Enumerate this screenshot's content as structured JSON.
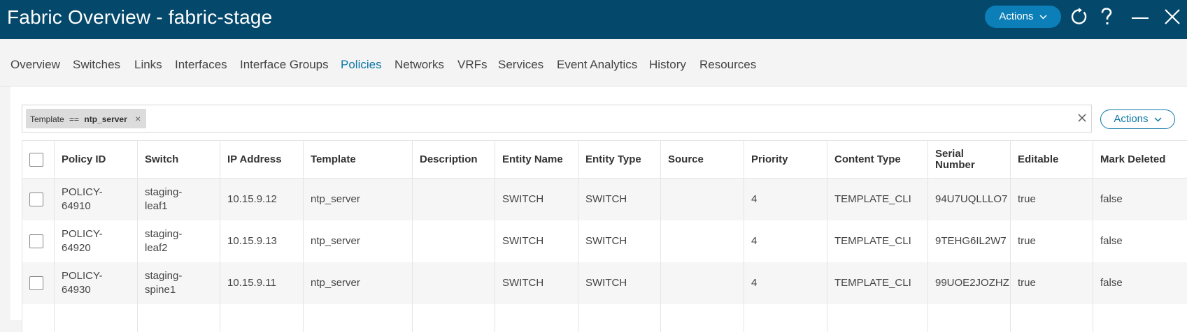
{
  "window": {
    "title": "Fabric Overview - fabric-stage",
    "actions_label": "Actions",
    "colors": {
      "titlebar": "#04486b",
      "primary": "#0c7fb8",
      "active_tab": "#0e77a8"
    }
  },
  "tabs": [
    {
      "label": "Overview"
    },
    {
      "label": "Switches"
    },
    {
      "label": "Links"
    },
    {
      "label": "Interfaces"
    },
    {
      "label": "Interface Groups"
    },
    {
      "label": "Policies",
      "active": true
    },
    {
      "label": "Networks"
    },
    {
      "label": "VRFs"
    },
    {
      "label": "Services"
    },
    {
      "label": "Event Analytics"
    },
    {
      "label": "History"
    },
    {
      "label": "Resources"
    }
  ],
  "filter": {
    "chip_key": "Template",
    "chip_op": "==",
    "chip_value": "ntp_server",
    "actions_label": "Actions"
  },
  "table": {
    "columns": [
      "Policy ID",
      "Switch",
      "IP Address",
      "Template",
      "Description",
      "Entity Name",
      "Entity Type",
      "Source",
      "Priority",
      "Content Type",
      "Serial Number",
      "Editable",
      "Mark Deleted"
    ],
    "rows": [
      {
        "policy_id_a": "POLICY-",
        "policy_id_b": "64910",
        "switch_a": "staging-",
        "switch_b": "leaf1",
        "ip": "10.15.9.12",
        "template": "ntp_server",
        "description": "",
        "entity_name": "SWITCH",
        "entity_type": "SWITCH",
        "source": "",
        "priority": "4",
        "content_type": "TEMPLATE_CLI",
        "serial": "94U7UQLLLO7",
        "editable": "true",
        "mark_deleted": "false"
      },
      {
        "policy_id_a": "POLICY-",
        "policy_id_b": "64920",
        "switch_a": "staging-",
        "switch_b": "leaf2",
        "ip": "10.15.9.13",
        "template": "ntp_server",
        "description": "",
        "entity_name": "SWITCH",
        "entity_type": "SWITCH",
        "source": "",
        "priority": "4",
        "content_type": "TEMPLATE_CLI",
        "serial": "9TEHG6IL2W7",
        "editable": "true",
        "mark_deleted": "false"
      },
      {
        "policy_id_a": "POLICY-",
        "policy_id_b": "64930",
        "switch_a": "staging-",
        "switch_b": "spine1",
        "ip": "10.15.9.11",
        "template": "ntp_server",
        "description": "",
        "entity_name": "SWITCH",
        "entity_type": "SWITCH",
        "source": "",
        "priority": "4",
        "content_type": "TEMPLATE_CLI",
        "serial": "99UOE2JOZHZ",
        "editable": "true",
        "mark_deleted": "false"
      }
    ]
  }
}
